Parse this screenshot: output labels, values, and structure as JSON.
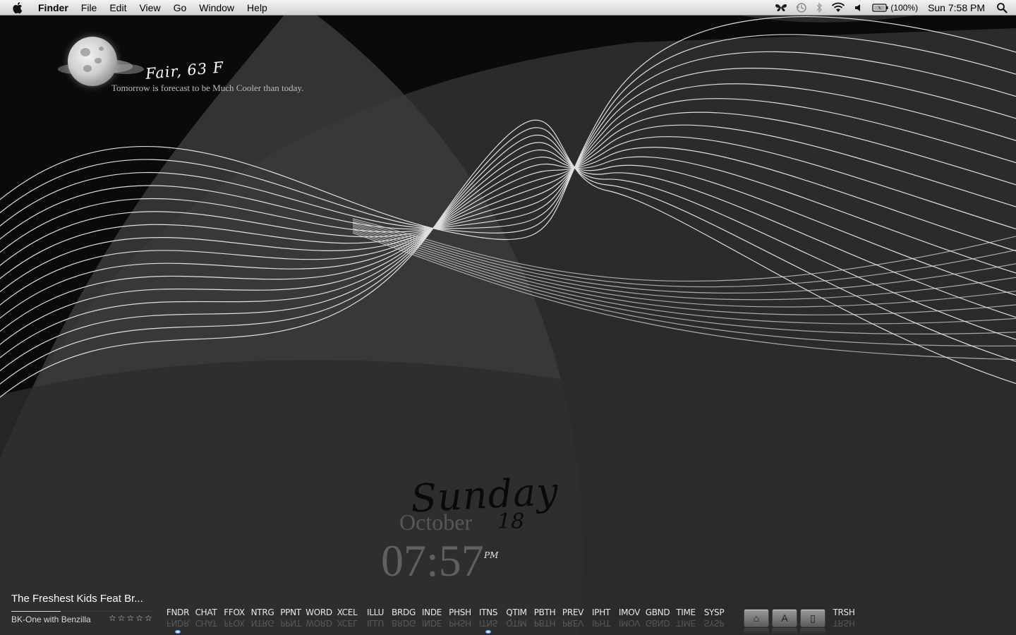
{
  "menubar": {
    "apple_icon": "apple-logo-icon",
    "app_name": "Finder",
    "menus": [
      "File",
      "Edit",
      "View",
      "Go",
      "Window",
      "Help"
    ],
    "status_icons": [
      "butterfly-icon",
      "time-machine-icon",
      "bluetooth-icon",
      "wifi-icon",
      "volume-icon",
      "battery-icon"
    ],
    "battery_percent": "(100%)",
    "clock": "Sun 7:58 PM",
    "spotlight_icon": "search-icon"
  },
  "weather": {
    "condition": "Fair, 63 F",
    "forecast": "Tomorrow is forecast to be Much Cooler than today.",
    "icon": "moon-cloud-icon"
  },
  "datetime": {
    "day": "Sunday",
    "month": "October",
    "date": "18",
    "time": "07:57",
    "ampm": "PM"
  },
  "now_playing": {
    "title": "The Freshest Kids Feat Br...",
    "artist": "BK-One with Benzilla",
    "stars": "☆☆☆☆☆",
    "rating": 0,
    "progress": 0.35
  },
  "dock": {
    "items": [
      {
        "label": "FNDR",
        "running": true
      },
      {
        "label": "CHAT",
        "running": false
      },
      {
        "label": "FFOX",
        "running": false
      },
      {
        "label": "NTRG",
        "running": false
      },
      {
        "label": "PPNT",
        "running": false
      },
      {
        "label": "WORD",
        "running": false
      },
      {
        "label": "XCEL",
        "running": false
      },
      {
        "label": "ILLU",
        "running": false
      },
      {
        "label": "BRDG",
        "running": false
      },
      {
        "label": "INDE",
        "running": false
      },
      {
        "label": "PHSH",
        "running": false
      },
      {
        "label": "ITNS",
        "running": true
      },
      {
        "label": "QTIM",
        "running": false
      },
      {
        "label": "PBTH",
        "running": false
      },
      {
        "label": "PREV",
        "running": false
      },
      {
        "label": "IPHT",
        "running": false
      },
      {
        "label": "IMOV",
        "running": false
      },
      {
        "label": "GBND",
        "running": false
      },
      {
        "label": "TIME",
        "running": false
      },
      {
        "label": "SYSP",
        "running": false
      }
    ],
    "stacks": [
      {
        "name": "home-stack",
        "glyph": "⌂"
      },
      {
        "name": "applications-stack",
        "glyph": "A"
      },
      {
        "name": "documents-stack",
        "glyph": "▯"
      }
    ],
    "trash_label": "TRSH"
  },
  "colors": {
    "background": "#000000",
    "menubar": "#e0e0e0",
    "lines": "#ffffff"
  }
}
